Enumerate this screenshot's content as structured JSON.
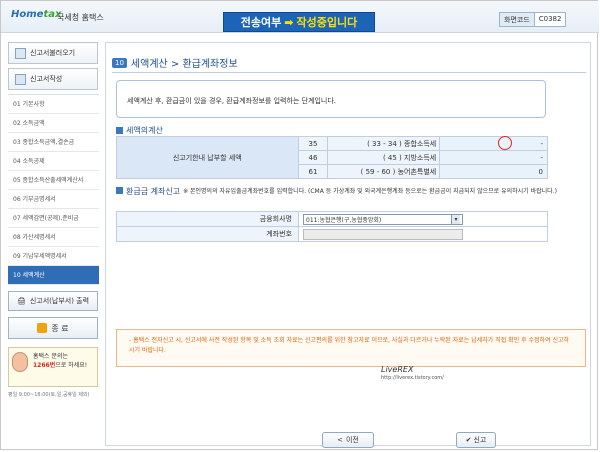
{
  "header": {
    "logo_home": "Home",
    "logo_tax": "tax",
    "subtitle": "국세청 홈택스",
    "status_part1": "전송여부",
    "status_arrow": "➡",
    "status_part2": "작성중입니다",
    "screen_code_label": "화면코드",
    "screen_code_value": "C0382"
  },
  "sidebar": {
    "load_button": "신고서불러오기",
    "write_button": "신고서작성",
    "items": [
      "01 기본사항",
      "02 소득금액",
      "03 종합소득금액,결손금",
      "04 소득공제",
      "05 종합소득산출세액계산서",
      "06 기부금명세서",
      "07 세액감면(공제),준비금",
      "08 가산세명세서",
      "09 기납부세액명세서",
      "10 세액계산"
    ],
    "active_index": 9,
    "print_button": "신고서(납부서) 출력",
    "end_button": "종 료",
    "help_line1": "홈택스 문의는",
    "help_number": "1266번",
    "help_line2": "으로 하세요!",
    "help_hours": "평일 9:00~18:00(토,일,공휴일 제외)"
  },
  "main": {
    "title_num": "10",
    "title": "세액계산 > 환급계좌정보",
    "info": "세액계산 후, 환급금이 있을 경우, 환급계좌정보를 입력하는 단계입니다.",
    "tax_section": "세액의계산",
    "tax_head": "신고기한내 납부할 세액",
    "tax_rows": [
      {
        "no": "35",
        "label": "( 33 - 34 ) 종합소득세",
        "value": "-"
      },
      {
        "no": "46",
        "label": "( 45 ) 지방소득세",
        "value": "-"
      },
      {
        "no": "61",
        "label": "( 59 - 60 ) 농어촌특별세",
        "value": "0"
      }
    ],
    "refund_section": "환급금 계좌신고",
    "refund_note": "※ 본인명의의 자유입출금계좌번호를 입력합니다. (CMA 등 가상계좌 및 외국계은행계좌 등으로는 환급금이 지급되지 않으므로 유의하시기 바랍니다.)",
    "bank_label": "금융회사명",
    "bank_value": "011:농협은행(구,농협중앙회)",
    "account_label": "계좌번호",
    "notice": "- 홈택스 전자신고 시, 신고서에 사전 작성된 항목 및 소득 조회 자료는 신고편의를 위한 참고자료 이므로, 사실과 다르거나 누락된 자료는 납세자가 직접 확인 후 수정하여 신고하시기 바랍니다.",
    "prev_button": "이전",
    "next_button": "신고"
  },
  "watermark": {
    "text": "LiveREX",
    "url": "http://liverex.tistory.com/"
  }
}
